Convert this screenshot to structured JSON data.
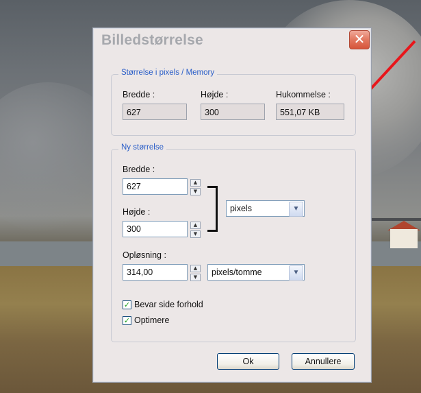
{
  "dialog": {
    "title": "Billedstørrelse",
    "close_glyph": "✕"
  },
  "memory_group": {
    "title": "Størrelse i pixels / Memory",
    "width_label": "Bredde :",
    "width_value": "627",
    "height_label": "Højde :",
    "height_value": "300",
    "memory_label": "Hukommelse :",
    "memory_value": "551,07 KB"
  },
  "new_size_group": {
    "title": "Ny størrelse",
    "width_label": "Bredde :",
    "width_value": "627",
    "height_label": "Højde :",
    "height_value": "300",
    "unit_selected": "pixels",
    "resolution_label": "Opløsning :",
    "resolution_value": "314,00",
    "resolution_unit_selected": "pixels/tomme",
    "keep_ratio_label": "Bevar side forhold",
    "keep_ratio_checked": true,
    "optimize_label": "Optimere",
    "optimize_checked": true
  },
  "buttons": {
    "ok_label": "Ok",
    "cancel_label": "Annullere"
  },
  "icons": {
    "spin_up": "▲",
    "spin_down": "▼",
    "dropdown": "▼",
    "check": "✓"
  },
  "colors": {
    "annotation_arrow": "#e8161b",
    "group_title": "#2a5ec8",
    "close_button": "#d6553a"
  }
}
